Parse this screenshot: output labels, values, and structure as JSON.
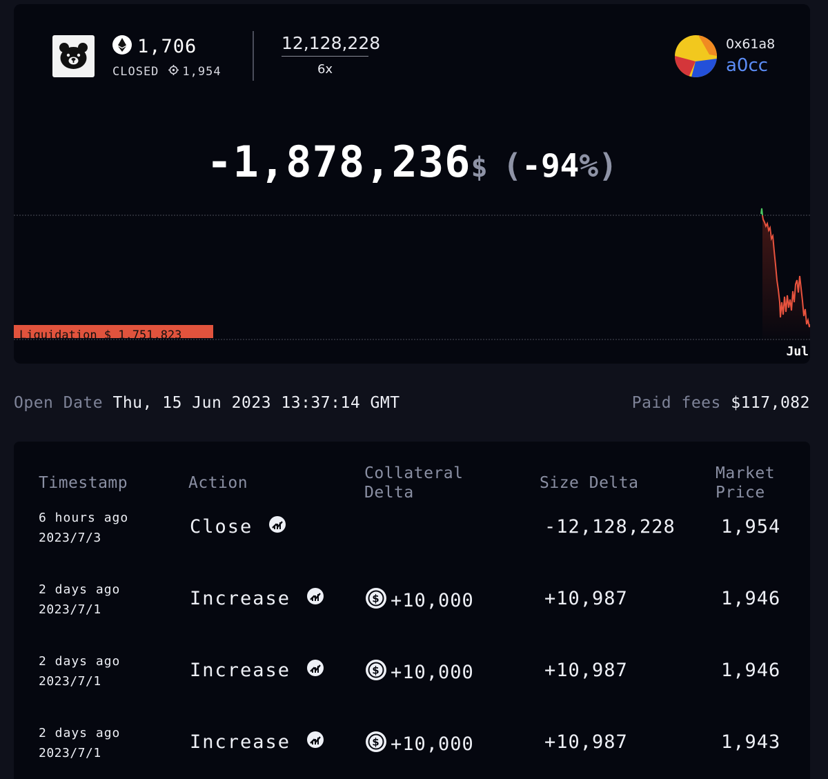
{
  "position": {
    "entry_price": "1,706",
    "status_label": "CLOSED",
    "close_price": "1,954",
    "size": "12,128,228",
    "leverage": "6x",
    "account_short": "0x61a8",
    "account_suffix": "a0cc",
    "pnl_value": "-1,878,236",
    "pnl_currency": "$",
    "pnl_percent_open": "(",
    "pnl_percent": "-94",
    "pnl_percent_sign": "%",
    "pnl_percent_close": ")"
  },
  "chart": {
    "liquidation_label": "Liquidation $ 1,751,823",
    "month_label": "Jul",
    "line_color": "#e8533e",
    "start_color": "#4cc861"
  },
  "meta": {
    "open_date_label": "Open Date",
    "open_date_value": "Thu, 15 Jun 2023 13:37:14 GMT",
    "fees_label": "Paid fees",
    "fees_value": "$117,082"
  },
  "table": {
    "headers": {
      "timestamp": "Timestamp",
      "action": "Action",
      "collateral_1": "Collateral",
      "collateral_2": "Delta",
      "size_delta": "Size Delta",
      "market_1": "Market",
      "market_2": "Price"
    },
    "rows": [
      {
        "ago": "6 hours ago",
        "date": "2023/7/3",
        "action": "Close",
        "collateral": "",
        "size": "-12,128,228",
        "price": "1,954"
      },
      {
        "ago": "2 days ago",
        "date": "2023/7/1",
        "action": "Increase",
        "collateral": "+10,000",
        "size": "+10,987",
        "price": "1,946"
      },
      {
        "ago": "2 days ago",
        "date": "2023/7/1",
        "action": "Increase",
        "collateral": "+10,000",
        "size": "+10,987",
        "price": "1,946"
      },
      {
        "ago": "2 days ago",
        "date": "2023/7/1",
        "action": "Increase",
        "collateral": "+10,000",
        "size": "+10,987",
        "price": "1,943"
      }
    ]
  },
  "icons": {
    "brand": "bear-logo-icon",
    "token": "ethereum-icon",
    "target": "target-icon",
    "avatar": "account-avatar-icon",
    "tx_link": "gmx-link-icon",
    "collateral_token": "usd-coin-icon"
  }
}
